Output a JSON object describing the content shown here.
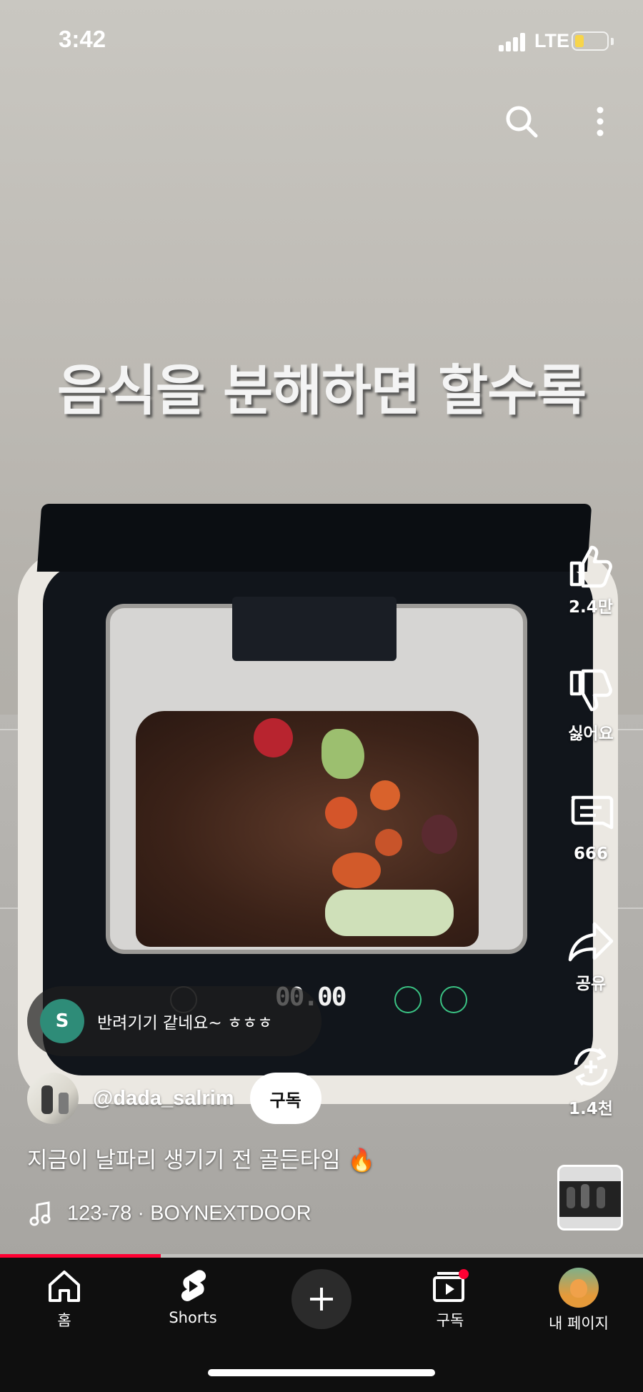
{
  "status_bar": {
    "time": "3:42",
    "network": "LTE"
  },
  "video": {
    "caption": "음식을 분해하면 할수록",
    "display_readout": "00.00"
  },
  "actions": {
    "like_count": "2.4만",
    "dislike_label": "싫어요",
    "comment_count": "666",
    "share_label": "공유",
    "remix_count": "1.4천"
  },
  "comment_preview": {
    "avatar_letter": "S",
    "text": "반려기기 같네요~ ㅎㅎㅎ"
  },
  "channel": {
    "handle": "@dada_salrim",
    "subscribe_label": "구독"
  },
  "title": "지금이 날파리 생기기 전 골든타임 🔥",
  "music": {
    "track": "123-78 · BOYNEXTDOOR"
  },
  "playback": {
    "progress_percent": 25
  },
  "nav": {
    "items": [
      {
        "label": "홈",
        "icon": "home-icon"
      },
      {
        "label": "Shorts",
        "icon": "shorts-icon"
      },
      {
        "label": "",
        "icon": "create-icon"
      },
      {
        "label": "구독",
        "icon": "subscriptions-icon"
      },
      {
        "label": "내 페이지",
        "icon": "profile-avatar"
      }
    ]
  },
  "colors": {
    "accent": "#ff0033",
    "nav_bg": "#0f0f0f",
    "notification_dot": "#ff0033"
  }
}
